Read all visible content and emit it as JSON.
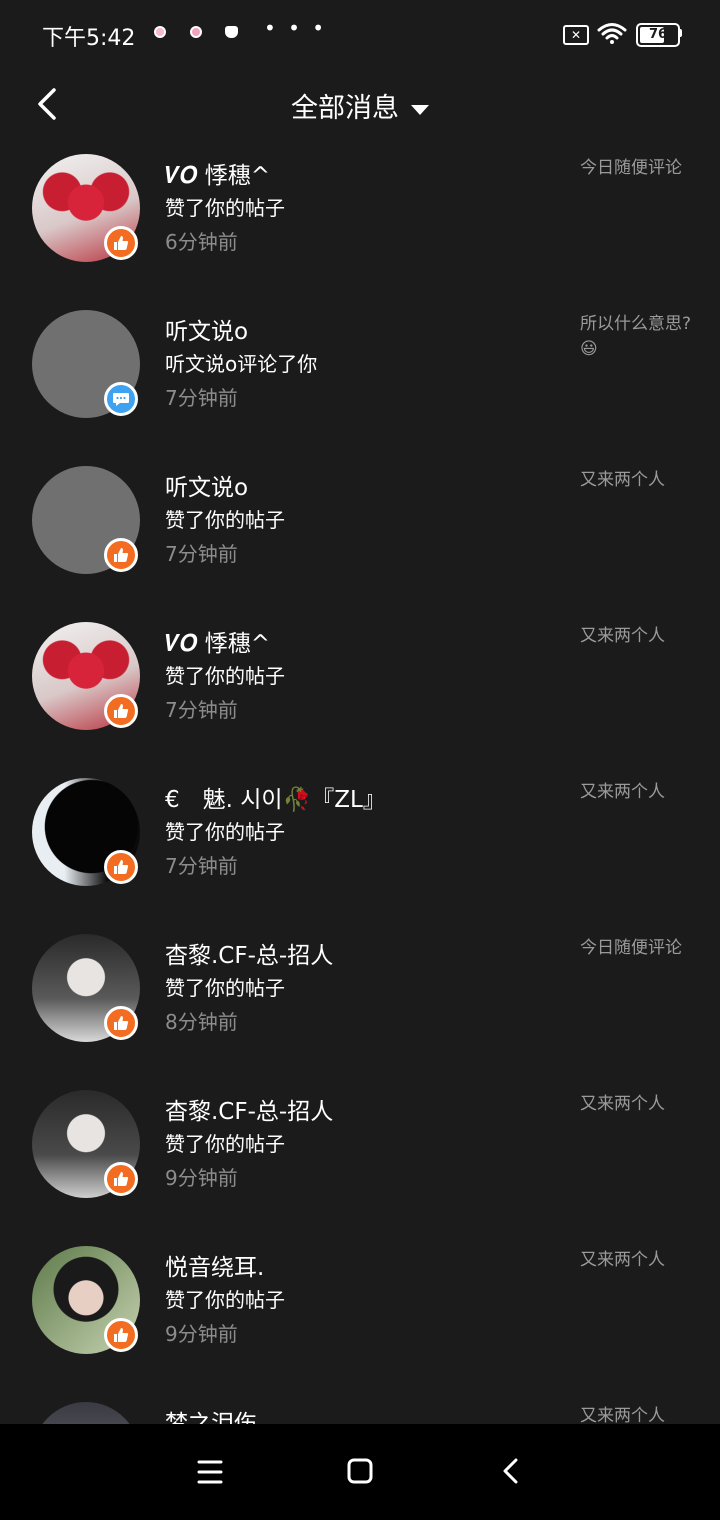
{
  "status_bar": {
    "time": "下午5:42",
    "dots": "• • •",
    "battery_level": "76",
    "battery_fraction": 0.76
  },
  "header": {
    "title": "全部消息"
  },
  "messages": [
    {
      "user": "𝑽𝑶 悸穗^",
      "action": "赞了你的帖子",
      "time": "6分钟前",
      "preview": "今日随便评论",
      "type": "like"
    },
    {
      "user": "听文说o",
      "action": "听文说o评论了你",
      "time": "7分钟前",
      "preview": "所以什么意思? 😃",
      "type": "comment"
    },
    {
      "user": "听文说o",
      "action": "赞了你的帖子",
      "time": "7分钟前",
      "preview": "又来两个人",
      "type": "like"
    },
    {
      "user": "𝑽𝑶 悸穗^",
      "action": "赞了你的帖子",
      "time": "7分钟前",
      "preview": "又来两个人",
      "type": "like"
    },
    {
      "user": "€　魅. 시이🥀『ZL』",
      "action": "赞了你的帖子",
      "time": "7分钟前",
      "preview": "又来两个人",
      "type": "like"
    },
    {
      "user": "杳黎.CF-总-招人",
      "action": "赞了你的帖子",
      "time": "8分钟前",
      "preview": "今日随便评论",
      "type": "like"
    },
    {
      "user": "杳黎.CF-总-招人",
      "action": "赞了你的帖子",
      "time": "9分钟前",
      "preview": "又来两个人",
      "type": "like"
    },
    {
      "user": "悦音绕耳.",
      "action": "赞了你的帖子",
      "time": "9分钟前",
      "preview": "又来两个人",
      "type": "like"
    },
    {
      "user": "梦之泪伤",
      "action": "",
      "time": "",
      "preview": "又来两个人",
      "type": "like"
    }
  ],
  "colors": {
    "background": "#1b1b1b",
    "like_badge": "#f26d21",
    "comment_badge": "#3fa2f0",
    "secondary_text": "#8c8c8c"
  }
}
